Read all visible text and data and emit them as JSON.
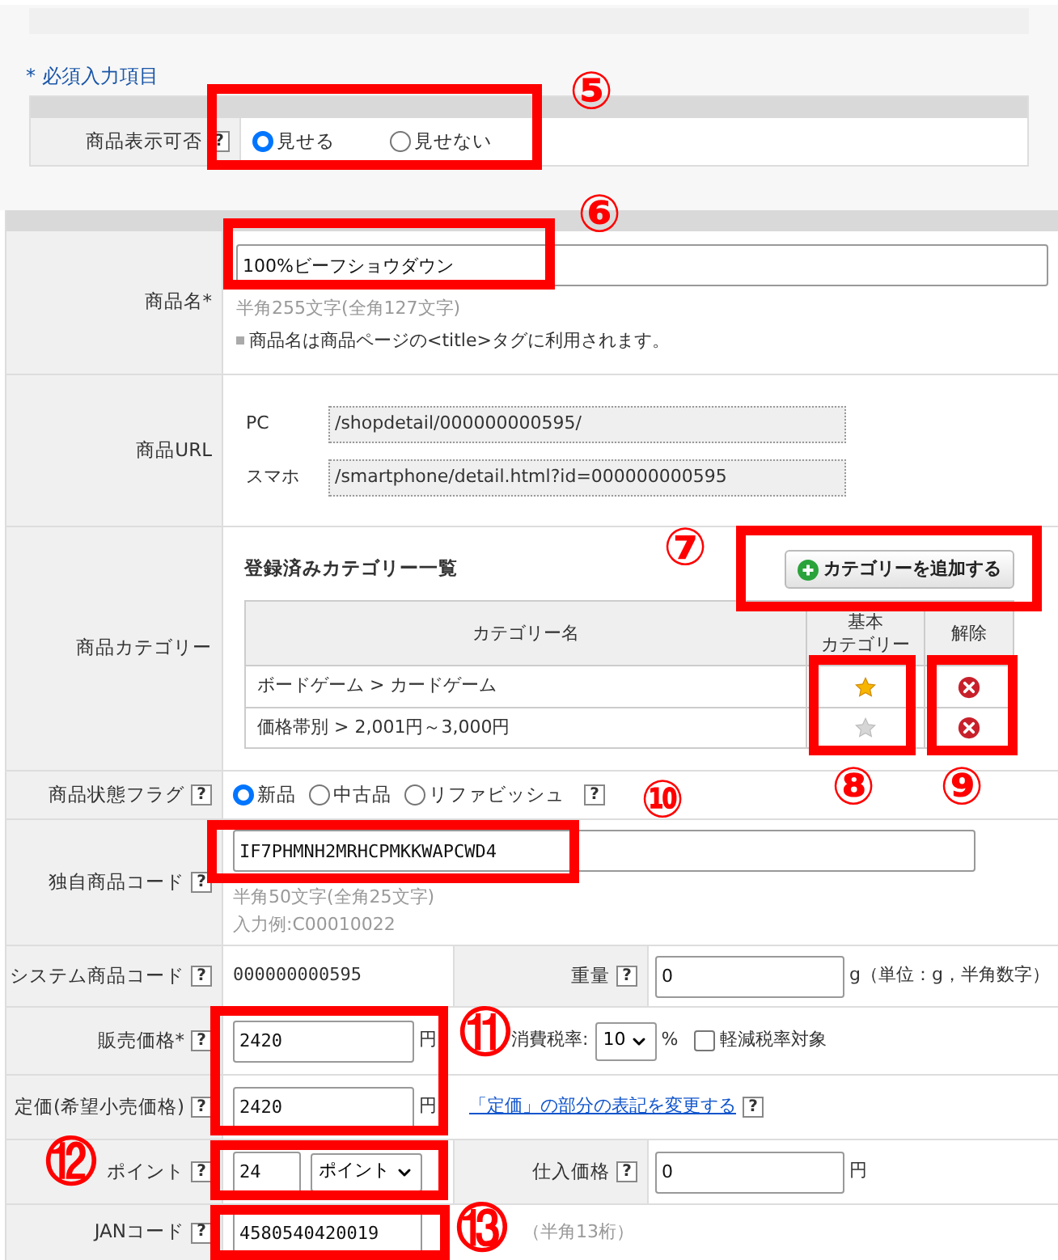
{
  "required_note": "* 必須入力項目",
  "display_setting": {
    "label": "商品表示可否",
    "help": "?",
    "options": [
      {
        "label": "見せる",
        "selected": true
      },
      {
        "label": "見せない",
        "selected": false
      }
    ]
  },
  "product_name": {
    "label": "商品名*",
    "value": "100%ビーフショウダウン",
    "hint": "半角255文字(全角127文字)",
    "note": "商品名は商品ページの<title>タグに利用されます。"
  },
  "product_url": {
    "label": "商品URL",
    "rows": [
      {
        "label": "PC",
        "value": "/shopdetail/000000000595/"
      },
      {
        "label": "スマホ",
        "value": "/smartphone/detail.html?id=000000000595"
      }
    ]
  },
  "category": {
    "label": "商品カテゴリー",
    "heading": "登録済みカテゴリー一覧",
    "add_button": "カテゴリーを追加する",
    "columns": [
      {
        "lines": [
          "カテゴリー名"
        ]
      },
      {
        "lines": [
          "基本",
          "カテゴリー"
        ]
      },
      {
        "lines": [
          "解除"
        ]
      }
    ],
    "rows": [
      {
        "name": "ボードゲーム > カードゲーム",
        "primary": true
      },
      {
        "name": "価格帯別 > 2,001円～3,000円",
        "primary": false
      }
    ]
  },
  "condition": {
    "label": "商品状態フラグ",
    "help": "?",
    "options": [
      {
        "label": "新品",
        "selected": true
      },
      {
        "label": "中古品",
        "selected": false
      },
      {
        "label": "リファビッシュ",
        "selected": false
      }
    ],
    "options_help": "?"
  },
  "own_code": {
    "label": "独自商品コード",
    "help": "?",
    "value": "IF7PHMNH2MRHCPMKKWAPCWD4",
    "hint": "半角50文字(全角25文字)",
    "example": "入力例:C00010022"
  },
  "system_code": {
    "label": "システム商品コード",
    "help": "?",
    "value": "000000000595"
  },
  "weight": {
    "label": "重量",
    "help": "?",
    "value": "0",
    "unit": "g（単位：g，半角数字）"
  },
  "sale_price": {
    "label": "販売価格*",
    "help": "?",
    "value": "2420",
    "unit": "円"
  },
  "tax": {
    "label": "消費税率:",
    "value": "10",
    "unit": "%",
    "reduced": {
      "label": "軽減税率対象",
      "checked": false
    }
  },
  "list_price": {
    "label": "定価(希望小売価格)",
    "help": "?",
    "value": "2420",
    "unit": "円",
    "link": "「定価」の部分の表記を変更する",
    "link_help": "?"
  },
  "point": {
    "label": "ポイント",
    "help": "?",
    "value": "24",
    "unit_select": "ポイント"
  },
  "purchase_price": {
    "label": "仕入価格",
    "help": "?",
    "value": "0",
    "unit": "円"
  },
  "jan": {
    "label": "JANコード",
    "help": "?",
    "value": "4580540420019",
    "hint": "（半角13桁）"
  },
  "markers": [
    "⑤",
    "⑥",
    "⑦",
    "⑩",
    "⑧",
    "⑨",
    "⑪",
    "⑫",
    "⑬"
  ]
}
